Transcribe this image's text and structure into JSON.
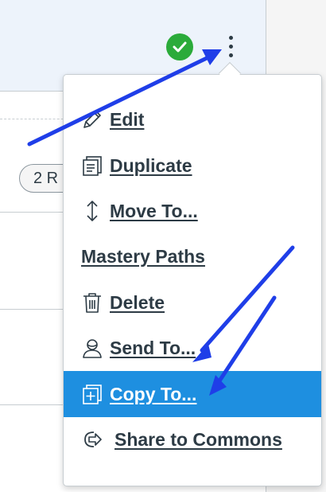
{
  "background": {
    "pill_text": "2 R"
  },
  "menu": {
    "items": [
      {
        "label": "Edit",
        "icon": "pencil-icon"
      },
      {
        "label": "Duplicate",
        "icon": "duplicate-icon"
      },
      {
        "label": "Move To...",
        "icon": "move-updown-icon"
      },
      {
        "label": "Mastery Paths",
        "icon": ""
      },
      {
        "label": "Delete",
        "icon": "trash-icon"
      },
      {
        "label": "Send To...",
        "icon": "user-send-icon"
      },
      {
        "label": "Copy To...",
        "icon": "copy-to-icon"
      },
      {
        "label": "Share to Commons",
        "icon": "share-commons-icon"
      }
    ],
    "active_item": "Copy To..."
  },
  "colors": {
    "published_green": "#2bab3a",
    "menu_highlight": "#1e8fe0",
    "annotation_arrow": "#1f3ee8"
  }
}
